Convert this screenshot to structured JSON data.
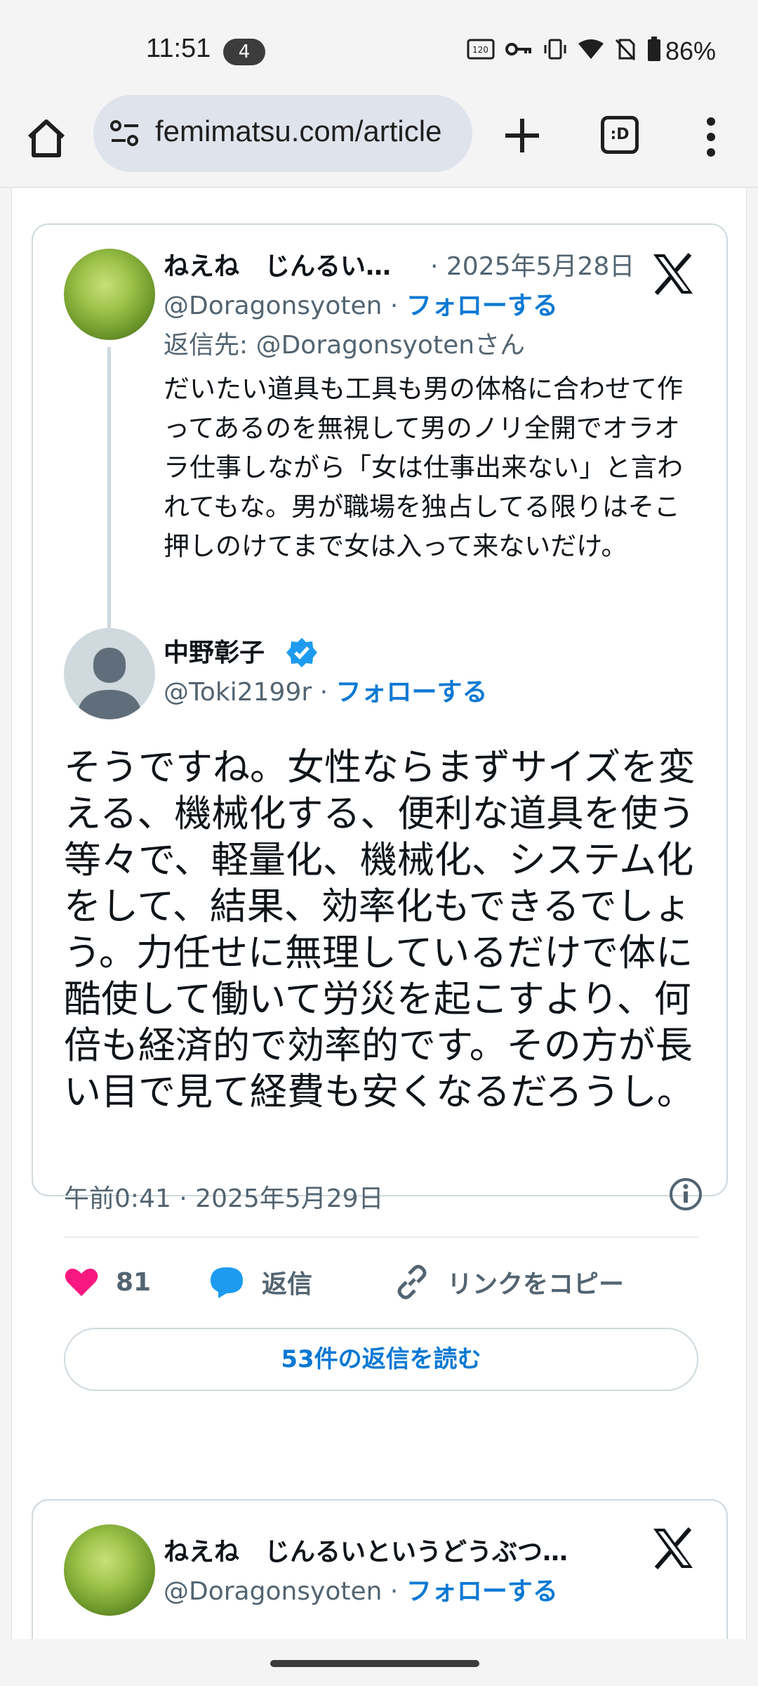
{
  "status": {
    "time": "11:51",
    "notification_count": "4",
    "battery": "86%"
  },
  "browser": {
    "url": "femimatsu.com/article",
    "tabs_label": ":D"
  },
  "tweet1": {
    "quoted": {
      "name": "ねえね　じんるい…",
      "date": "· 2025年5月28日",
      "handle": "@Doragonsyoten ·",
      "follow": "フォローする",
      "reply_to": "返信先: @Doragonsyotenさん",
      "text": "だいたい道具も工具も男の体格に合わせて作ってあるのを無視して男のノリ全開でオラオラ仕事しながら「女は仕事出来ない」と言われてもな。男が職場を独占してる限りはそこ押しのけてまで女は入って来ないだけ。"
    },
    "main": {
      "name": "中野彰子",
      "handle": "@Toki2199r ·",
      "follow": "フォローする",
      "text": "そうですね。女性ならまずサイズを変える、機械化する、便利な道具を使う等々で、軽量化、機械化、システム化をして、結果、効率化もできるでしょう。力任せに無理しているだけで体に酷使して働いて労災を起こすより、何倍も経済的で効率的です。その方が長い目で見て経費も安くなるだろうし。",
      "timestamp": "午前0:41 · 2025年5月29日"
    },
    "actions": {
      "likes": "81",
      "reply": "返信",
      "copy_link": "リンクをコピー"
    },
    "read_replies": "53件の返信を読む"
  },
  "tweet2": {
    "name": "ねえね　じんるいというどうぶつ…",
    "handle": "@Doragonsyoten ·",
    "follow": "フォローする"
  }
}
